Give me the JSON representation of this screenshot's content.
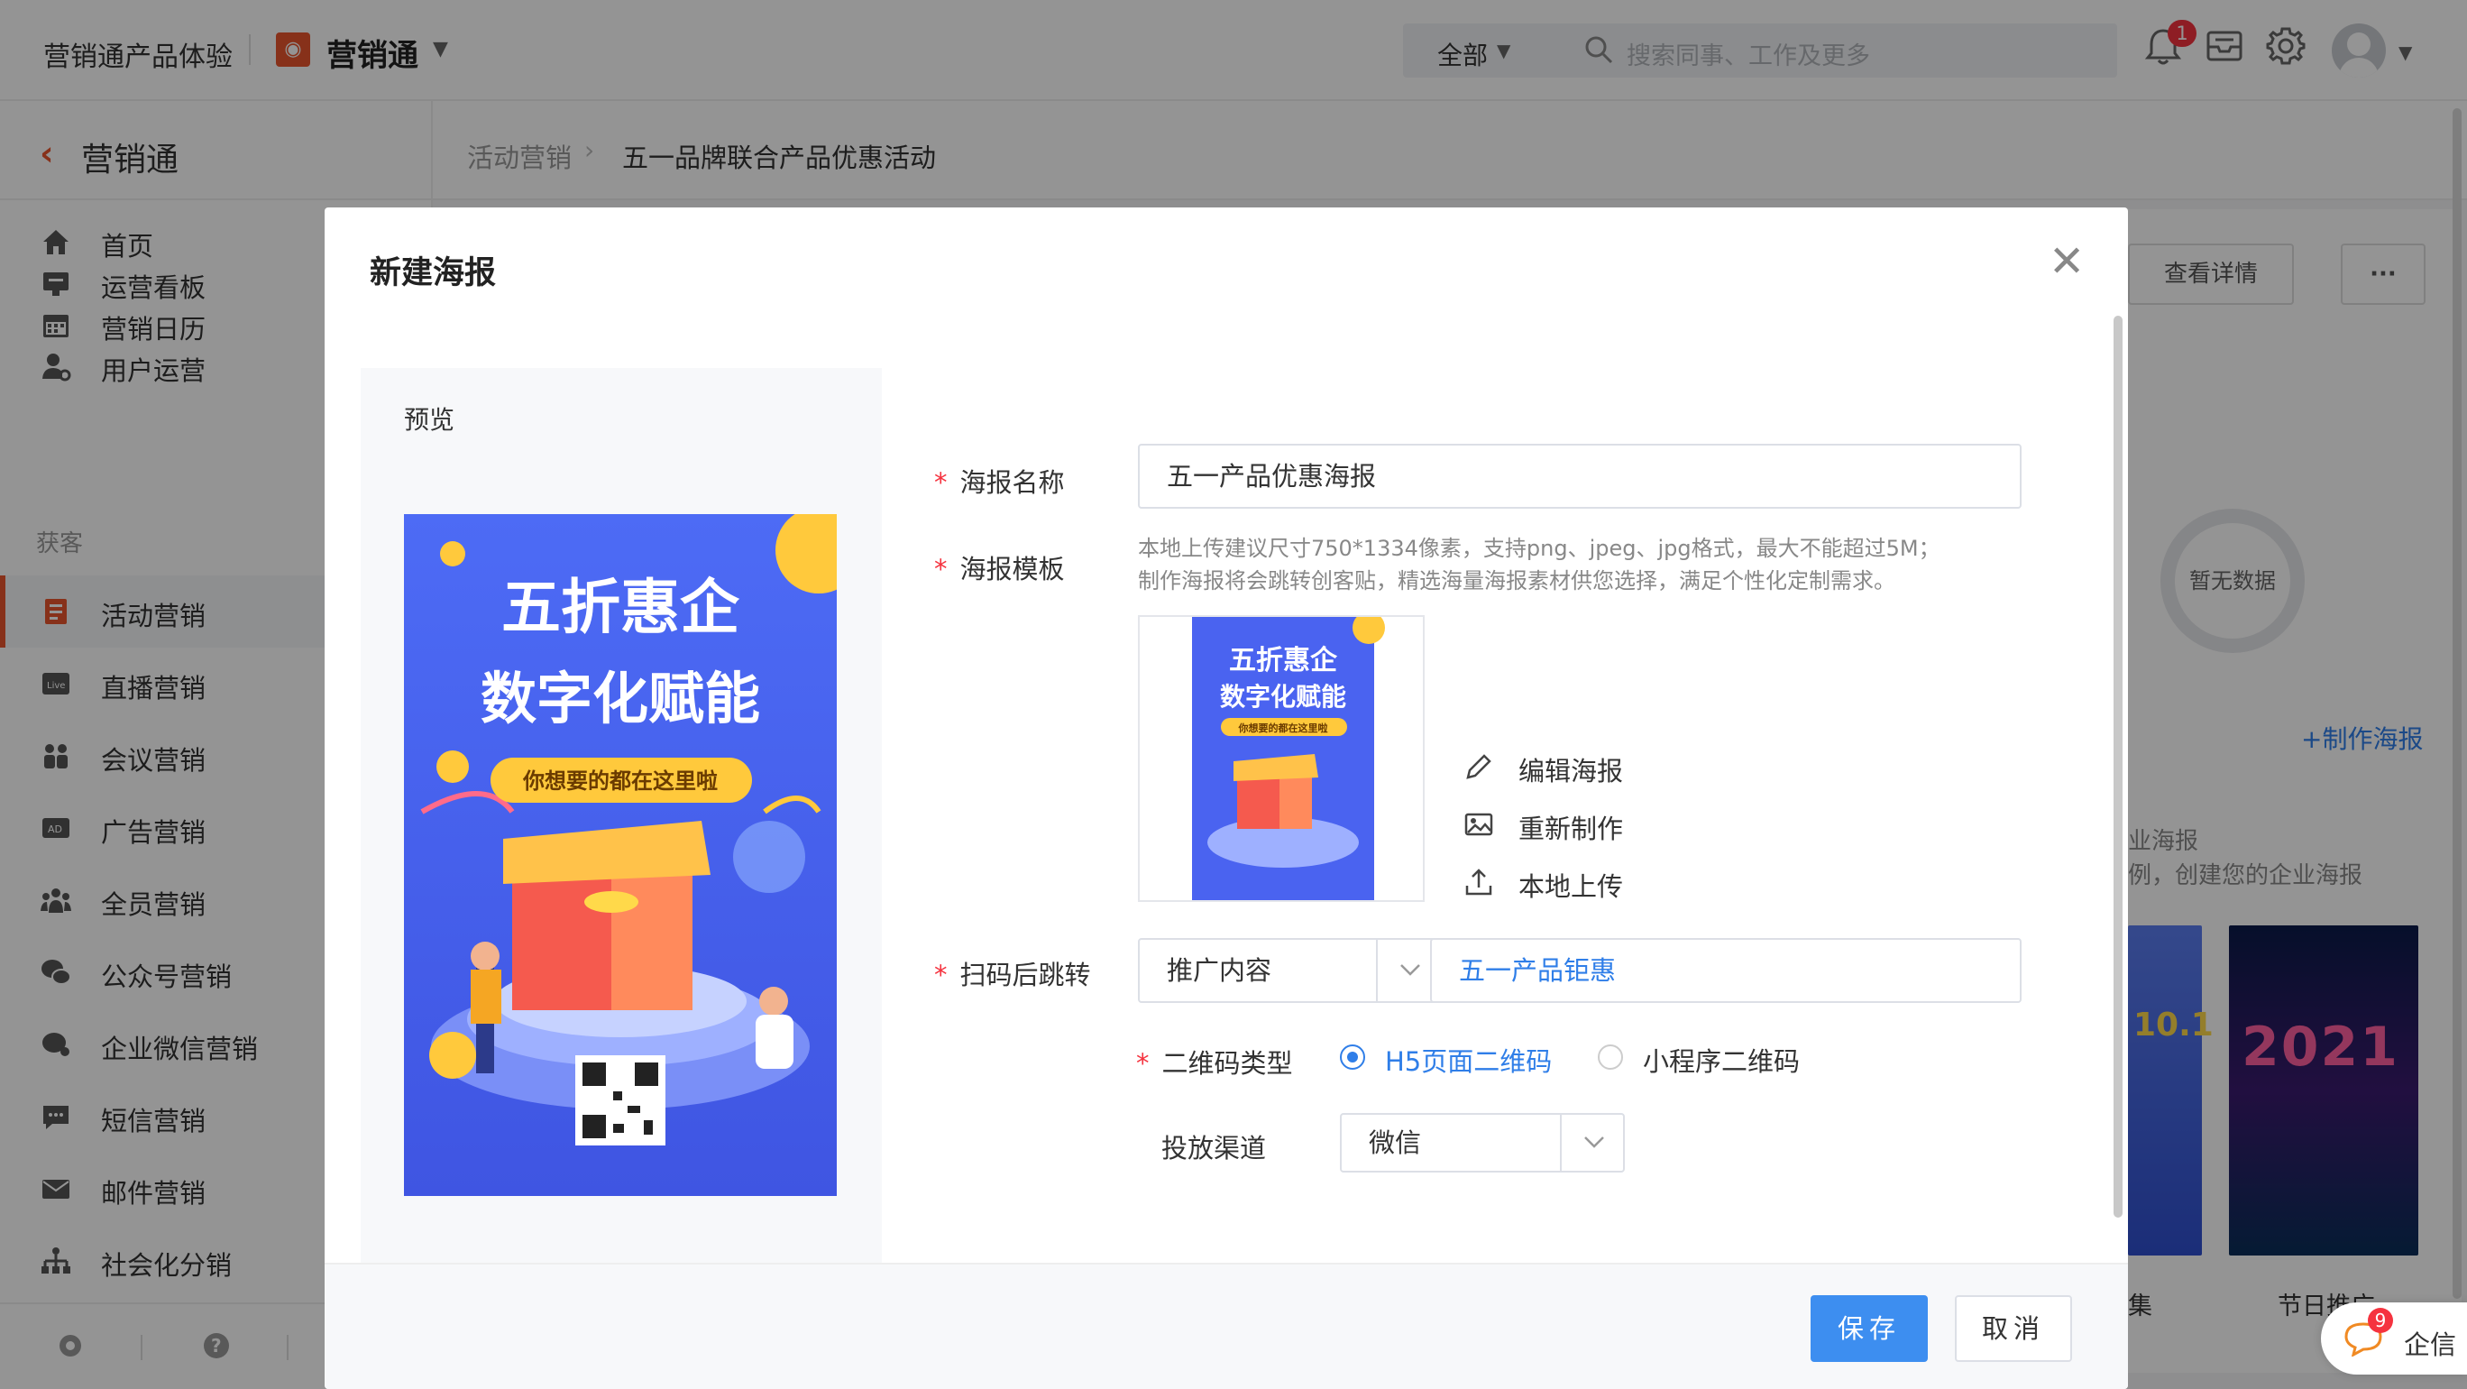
{
  "header": {
    "product_title": "营销通产品体验",
    "app_name": "营销通",
    "search_scope": "全部",
    "search_placeholder": "搜索同事、工作及更多",
    "notification_count": "1"
  },
  "sidebar": {
    "title": "营销通",
    "group_label": "获客",
    "items": [
      {
        "label": "首页",
        "icon": "home-icon"
      },
      {
        "label": "运营看板",
        "icon": "dashboard-icon"
      },
      {
        "label": "营销日历",
        "icon": "calendar-icon"
      },
      {
        "label": "用户运营",
        "icon": "user-ops-icon"
      },
      {
        "label": "活动营销",
        "icon": "activity-icon",
        "active": true
      },
      {
        "label": "直播营销",
        "icon": "live-icon"
      },
      {
        "label": "会议营销",
        "icon": "meeting-icon"
      },
      {
        "label": "广告营销",
        "icon": "ad-icon"
      },
      {
        "label": "全员营销",
        "icon": "all-staff-icon"
      },
      {
        "label": "公众号营销",
        "icon": "wechat-official-icon"
      },
      {
        "label": "企业微信营销",
        "icon": "wecom-icon"
      },
      {
        "label": "短信营销",
        "icon": "sms-icon"
      },
      {
        "label": "邮件营销",
        "icon": "mail-icon"
      },
      {
        "label": "社会化分销",
        "icon": "distribution-icon"
      }
    ]
  },
  "breadcrumb": {
    "parent": "活动营销",
    "current": "五一品牌联合产品优惠活动"
  },
  "background": {
    "view_details": "查看详情",
    "more": "···",
    "empty_data": "暂无数据",
    "make_poster": "+制作海报",
    "enterprise_poster_1": "业海报",
    "enterprise_poster_2": "例，创建您的企业海报",
    "card_caption_1": "集",
    "card_caption_2": "节日推广",
    "thumb_text_2021": "2021",
    "thumb_text_10": "10.1"
  },
  "modal": {
    "title": "新建海报",
    "preview_label": "预览",
    "poster": {
      "headline_1": "五折惠企",
      "headline_2": "数字化赋能",
      "tagline": "你想要的都在这里啦"
    },
    "fields": {
      "name_label": "海报名称",
      "name_value": "五一产品优惠海报",
      "template_label": "海报模板",
      "template_hint_1": "本地上传建议尺寸750*1334像素，支持png、jpeg、jpg格式，最大不能超过5M；",
      "template_hint_2": "制作海报将会跳转创客贴，精选海量海报素材供您选择，满足个性化定制需求。",
      "edit_poster": "编辑海报",
      "remake": "重新制作",
      "local_upload": "本地上传",
      "jump_label": "扫码后跳转",
      "jump_type": "推广内容",
      "jump_target": "五一产品钜惠",
      "qr_type_label": "二维码类型",
      "qr_h5": "H5页面二维码",
      "qr_mini": "小程序二维码",
      "channel_label": "投放渠道",
      "channel_value": "微信"
    },
    "save": "保存",
    "cancel": "取消"
  },
  "chat": {
    "label": "企信",
    "badge": "9"
  },
  "colors": {
    "accent": "#e8552e",
    "primary": "#3d8ef0",
    "link": "#2f7ee8",
    "required": "#f5333f",
    "poster_bg": "#4a63f0"
  }
}
